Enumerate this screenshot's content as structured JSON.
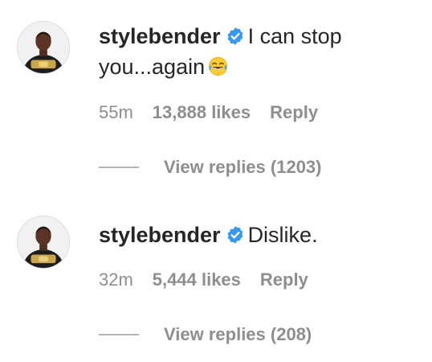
{
  "comments": [
    {
      "username": "stylebender",
      "verified": true,
      "text": "I can stop you...again",
      "emoji": "face-with-tears-of-joy-icon",
      "time": "55m",
      "likes": "13,888 likes",
      "reply_label": "Reply",
      "view_replies_label": "View replies (1203)"
    },
    {
      "username": "stylebender",
      "verified": true,
      "text": "Dislike.",
      "time": "32m",
      "likes": "5,444 likes",
      "reply_label": "Reply",
      "view_replies_label": "View replies (208)"
    }
  ],
  "colors": {
    "text_primary": "#262626",
    "text_secondary": "#8e8e8e",
    "verified_blue": "#3897f0",
    "background": "#ffffff"
  }
}
